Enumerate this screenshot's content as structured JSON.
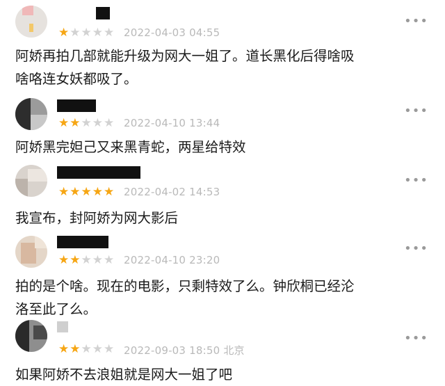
{
  "reviews": [
    {
      "stars": 1,
      "datetime": "2022-04-03 04:55",
      "location": "",
      "more": "•••",
      "text_lines": [
        "阿娇再拍几部就能升级为网大一姐了。道长黑化后得啥吸",
        "啥咯连女妖都吸了。"
      ]
    },
    {
      "stars": 2,
      "datetime": "2022-04-10 13:44",
      "location": "",
      "more": "•••",
      "text_lines": [
        "阿娇黑完妲己又来黑青蛇，两星给特效"
      ]
    },
    {
      "stars": 5,
      "datetime": "2022-04-02 14:53",
      "location": "",
      "more": "•••",
      "text_lines": [
        "我宣布，封阿娇为网大影后"
      ]
    },
    {
      "stars": 2,
      "datetime": "2022-04-10 23:20",
      "location": "",
      "more": "•••",
      "text_lines": [
        "拍的是个啥。现在的电影，只剩特效了么。钟欣桐已经沦",
        "洛至此了么。"
      ]
    },
    {
      "stars": 2,
      "datetime": "2022-09-03 18:50",
      "location": "北京",
      "more": "•••",
      "text_lines": [
        "如果阿娇不去浪姐就是网大一姐了吧"
      ]
    }
  ],
  "colors": {
    "star_on": "#f6a614",
    "star_off": "#d2d2d2",
    "meta": "#b9b9b9"
  },
  "icons": {
    "star": "star-icon",
    "more": "more-dots-icon"
  }
}
